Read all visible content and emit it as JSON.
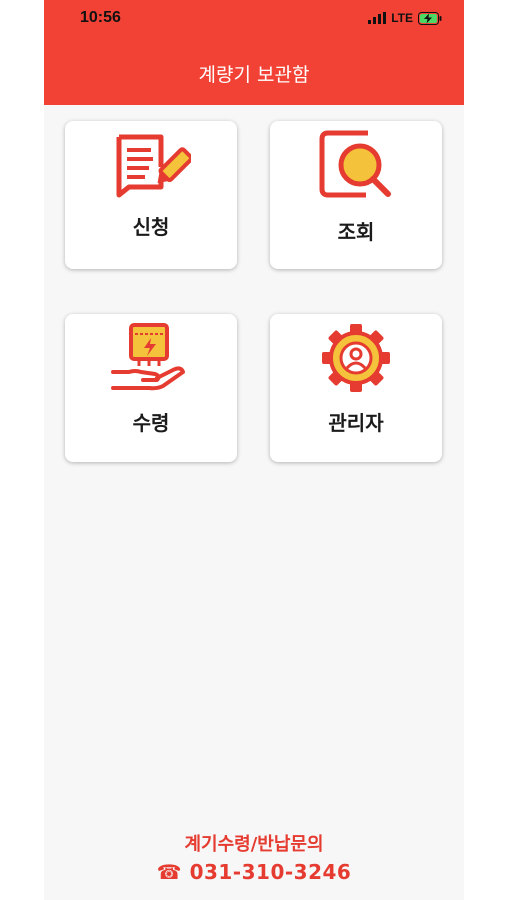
{
  "status_bar": {
    "time": "10:56",
    "network": "LTE"
  },
  "header": {
    "title": "계량기 보관함"
  },
  "menu": [
    {
      "label": "신청",
      "icon": "application-form-icon"
    },
    {
      "label": "조회",
      "icon": "search-icon"
    },
    {
      "label": "수령",
      "icon": "meter-receive-icon"
    },
    {
      "label": "관리자",
      "icon": "admin-gear-icon"
    }
  ],
  "footer": {
    "line1": "계기수령/반납문의",
    "phone_icon": "☎",
    "phone": "031-310-3246"
  },
  "colors": {
    "primary": "#f24236",
    "accent": "#f5c33b",
    "background": "#f7f7f7"
  }
}
